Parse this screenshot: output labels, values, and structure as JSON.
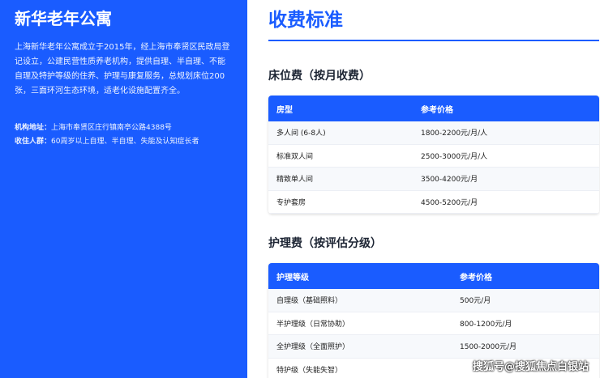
{
  "left": {
    "title": "新华老年公寓",
    "intro": "上海新华老年公寓成立于2015年，经上海市奉贤区民政局登记设立，公建民营性质养老机构，提供自理、半自理、不能自理及特护等级的住养、护理与康复服务，总规划床位200张，三面环河生态环境，适老化设施配置齐全。",
    "address_label": "机构地址：",
    "address": "上海市奉贤区庄行镇南亭公路4388号",
    "audience_label": "收住人群：",
    "audience": "60周岁以上自理、半自理、失能及认知症长者"
  },
  "right": {
    "heading": "收费标准",
    "bed_section": {
      "title": "床位费（按月收费）",
      "headers": [
        "房型",
        "参考价格"
      ],
      "rows": [
        [
          "多人间 (6-8人)",
          "1800-2200元/月/人"
        ],
        [
          "标准双人间",
          "2500-3000元/月/人"
        ],
        [
          "精致单人间",
          "3500-4200元/月"
        ],
        [
          "专护套房",
          "4500-5200元/月"
        ]
      ]
    },
    "care_section": {
      "title": "护理费（按评估分级）",
      "headers": [
        "护理等级",
        "参考价格"
      ],
      "rows": [
        [
          "自理级（基础照料）",
          "500元/月"
        ],
        [
          "半护理级（日常协助）",
          "800-1200元/月"
        ],
        [
          "全护理级（全面照护）",
          "1500-2000元/月"
        ],
        [
          "特护级（失能失智）",
          ""
        ]
      ]
    }
  },
  "watermark": "搜狐号@搜狐焦点白银站"
}
